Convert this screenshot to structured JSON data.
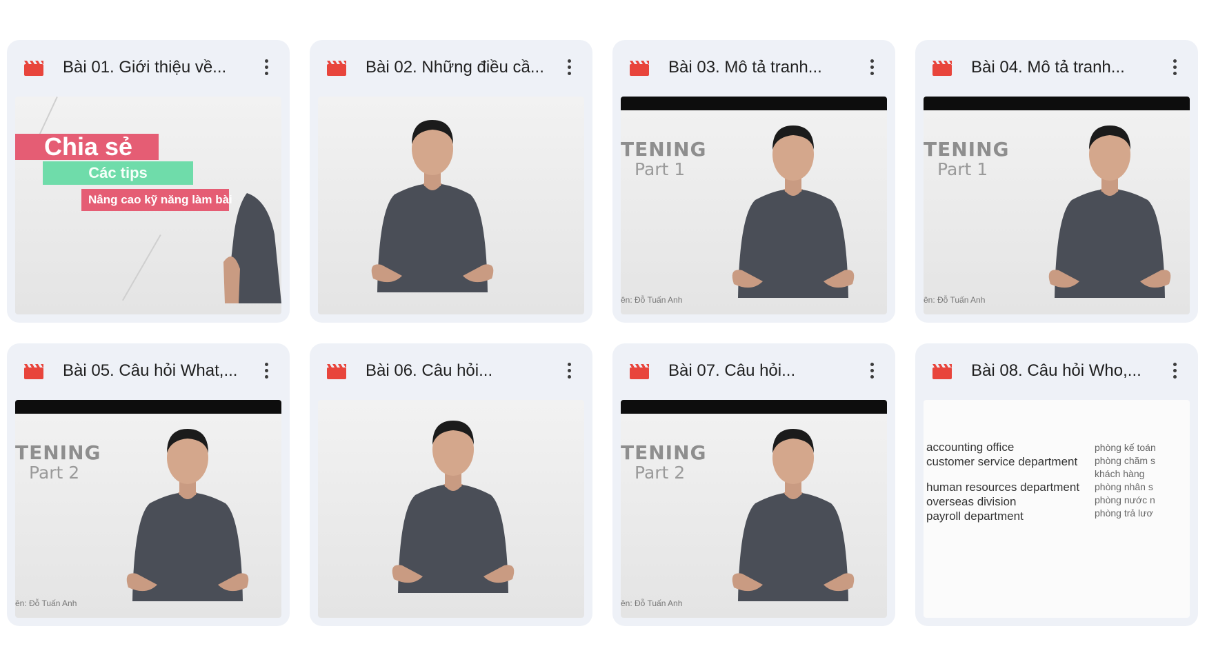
{
  "cards": [
    {
      "title": "Bài 01. Giới thiệu về...",
      "thumb": "intro"
    },
    {
      "title": "Bài 02. Những điều cầ...",
      "thumb": "plain"
    },
    {
      "title": "Bài 03. Mô tả tranh...",
      "thumb": "listening",
      "slide_title": "TENING",
      "slide_part": "Part 1",
      "presenter": "ên: Đỗ Tuấn Anh"
    },
    {
      "title": "Bài 04. Mô tả tranh...",
      "thumb": "listening",
      "slide_title": "TENING",
      "slide_part": "Part 1",
      "presenter": "ên: Đỗ Tuấn Anh"
    },
    {
      "title": "Bài 05. Câu hỏi What,...",
      "thumb": "listening",
      "slide_title": "TENING",
      "slide_part": "Part 2",
      "presenter": "ên: Đỗ Tuấn Anh"
    },
    {
      "title": "Bài 06. Câu hỏi...",
      "thumb": "plain"
    },
    {
      "title": "Bài 07. Câu hỏi...",
      "thumb": "listening",
      "slide_title": "TENING",
      "slide_part": "Part 2",
      "presenter": "ên: Đỗ Tuấn Anh"
    },
    {
      "title": "Bài 08. Câu hỏi Who,...",
      "thumb": "vocab"
    }
  ],
  "intro_banners": {
    "line1": "Chia sẻ",
    "line2": "Các tips",
    "line3": "Nâng cao kỹ năng làm bài"
  },
  "vocab": {
    "en": [
      "accounting office",
      "customer service department",
      "human resources department",
      "overseas division",
      "payroll department"
    ],
    "vi": [
      "phòng kế toán",
      "phòng chăm s",
      "khách hàng",
      "phòng nhân s",
      "phòng nước n",
      "phòng trả lươ"
    ]
  },
  "icons": {
    "file": "video-file-icon",
    "menu": "more-vert-icon"
  },
  "colors": {
    "icon": "#e8453c",
    "card_bg": "#eef1f7",
    "shirt": "#4a4e57"
  }
}
